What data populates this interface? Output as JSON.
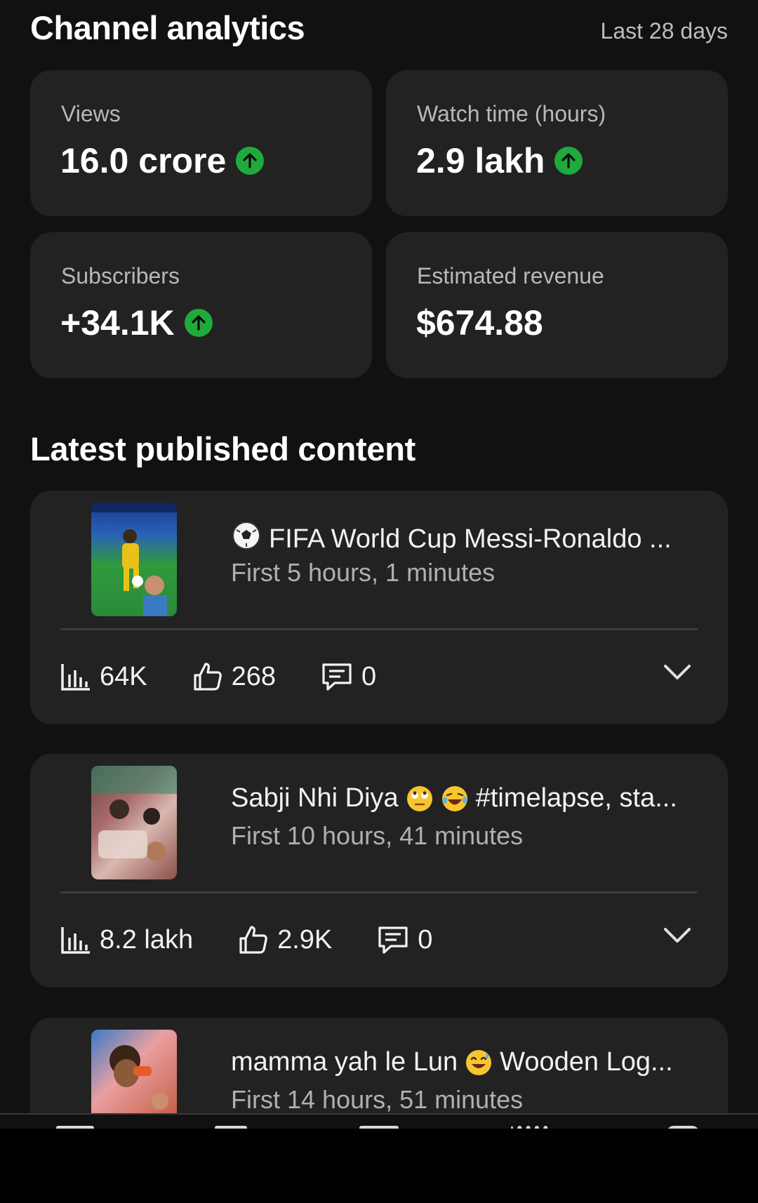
{
  "header": {
    "title": "Channel analytics",
    "period": "Last 28 days"
  },
  "metrics": [
    {
      "label": "Views",
      "value": "16.0 crore",
      "trend": "up"
    },
    {
      "label": "Watch time (hours)",
      "value": "2.9 lakh",
      "trend": "up"
    },
    {
      "label": "Subscribers",
      "value": "+34.1K",
      "trend": "up"
    },
    {
      "label": "Estimated revenue",
      "value": "$674.88",
      "trend": "none"
    }
  ],
  "section_title": "Latest published content",
  "content": [
    {
      "title": "FIFA World Cup Messi-Ronaldo ...",
      "leading_emoji": "soccer-ball",
      "subtitle": "First 5 hours, 1 minutes",
      "views": "64K",
      "likes": "268",
      "comments": "0"
    },
    {
      "title_a": "Sabji Nhi Diya",
      "title_b": "#timelapse, sta...",
      "subtitle": "First 10 hours, 41 minutes",
      "views": "8.2 lakh",
      "likes": "2.9K",
      "comments": "0"
    },
    {
      "title_a": "mamma yah le Lun",
      "title_b": "Wooden Log...",
      "subtitle": "First 14 hours, 51 minutes"
    }
  ],
  "colors": {
    "background": "#111111",
    "card": "#222222",
    "trend_up": "#1faa3c",
    "muted_text": "#b0b0b0"
  }
}
